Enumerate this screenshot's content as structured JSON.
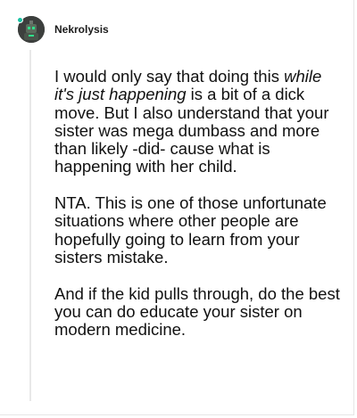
{
  "post": {
    "username": "Nekrolysis",
    "paragraph1": {
      "part1": "I would only say that doing this ",
      "emphasis": "while it's just happening",
      "part2": " is a bit of a dick move. But I also understand that your sister was mega dumbass and more than likely -did- cause what is happening with her child."
    },
    "paragraph2": "NTA. This is one of those unfortunate situations where other people are hopefully going to learn from your sisters mistake.",
    "paragraph3": "And if the kid pulls through, do the best you can do educate your sister on modern medicine."
  },
  "colors": {
    "text": "#111111",
    "status_dot": "#18c3a3",
    "avatar_bg": "#3c3f3d",
    "thread_line": "#e8e8e8"
  },
  "icons": {
    "avatar": "user-avatar-icon",
    "status": "online-status-icon"
  }
}
